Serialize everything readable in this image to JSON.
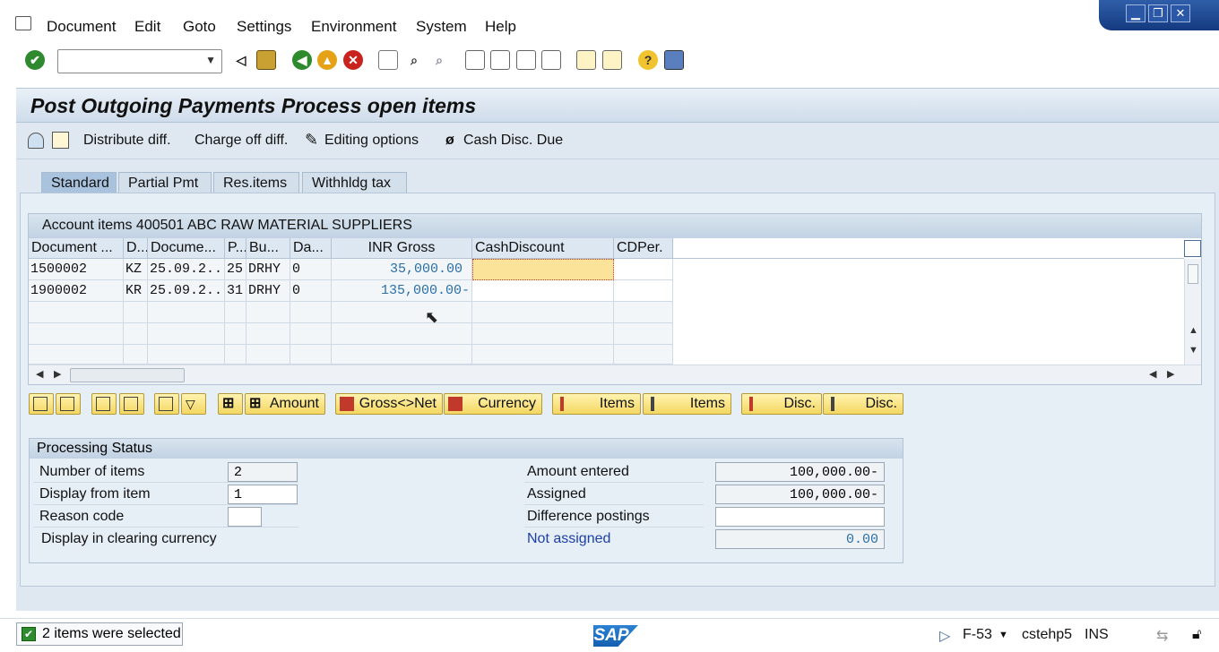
{
  "menu": {
    "items": [
      "Document",
      "Edit",
      "Goto",
      "Settings",
      "Environment",
      "System",
      "Help"
    ]
  },
  "window_controls": {
    "minimize": "▁",
    "restore": "❐",
    "close": "✕"
  },
  "toolbar": {
    "command_field_value": "",
    "icons": [
      "enter-icon",
      "back-arrow-icon",
      "save-icon",
      "back-icon",
      "exit-icon",
      "cancel-icon",
      "print-icon",
      "find-icon",
      "find-next-icon",
      "first-page-icon",
      "prev-page-icon",
      "next-page-icon",
      "last-page-icon",
      "new-session-icon",
      "shortcut-icon",
      "help-icon",
      "layout-icon"
    ]
  },
  "header": {
    "title": "Post Outgoing Payments Process open items"
  },
  "app_toolbar": {
    "distribute": "Distribute diff.",
    "charge_off": "Charge off diff.",
    "editing_options": "Editing options",
    "cash_disc_due": "Cash Disc. Due"
  },
  "tabs": [
    {
      "label": "Standard",
      "active": true
    },
    {
      "label": "Partial Pmt",
      "active": false
    },
    {
      "label": "Res.items",
      "active": false
    },
    {
      "label": "Withhldg tax",
      "active": false
    }
  ],
  "table": {
    "title": "Account items 400501 ABC RAW MATERIAL SUPPLIERS",
    "columns": [
      "Document ...",
      "D...",
      "Docume...",
      "P...",
      "Bu...",
      "Da...",
      "INR Gross",
      "CashDiscount",
      "CDPer."
    ],
    "rows": [
      [
        "1500002",
        "KZ",
        "25.09.2...",
        "25",
        "DRHY",
        "0",
        "35,000.00",
        "",
        ""
      ],
      [
        "1900002",
        "KR",
        "25.09.2...",
        "31",
        "DRHY",
        "0",
        "135,000.00-",
        "",
        ""
      ]
    ]
  },
  "buttons": {
    "amount": "Amount",
    "gross_net": "Gross<>Net",
    "currency": "Currency",
    "items_1": "Items",
    "items_2": "Items",
    "disc_1": "Disc.",
    "disc_2": "Disc."
  },
  "processing": {
    "title": "Processing Status",
    "number_of_items_label": "Number of items",
    "number_of_items": "2",
    "display_from_label": "Display from item",
    "display_from": "1",
    "reason_code_label": "Reason code",
    "reason_code": "",
    "clearing_currency_label": "Display in clearing currency",
    "amount_entered_label": "Amount entered",
    "amount_entered": "100,000.00-",
    "assigned_label": "Assigned",
    "assigned": "100,000.00-",
    "difference_label": "Difference postings",
    "difference": "",
    "not_assigned_label": "Not assigned",
    "not_assigned": "0.00"
  },
  "status_bar": {
    "message": "2 items were selected",
    "transaction": "F-53",
    "server": "cstehp5",
    "mode": "INS",
    "logo": "SAP"
  },
  "colors": {
    "panel_bg": "#dfe8f1",
    "button_yellow": "#f3d761",
    "focus_cell": "#fbe49a",
    "link_blue": "#1d3fa8",
    "amount_blue": "#2a6fa6"
  }
}
